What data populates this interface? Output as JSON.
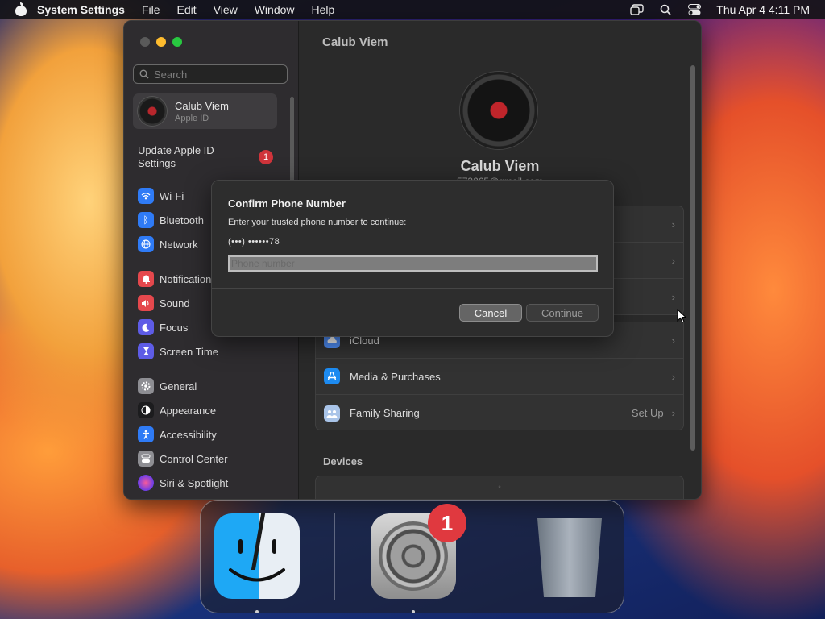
{
  "menubar": {
    "app_name": "System Settings",
    "items": [
      "File",
      "Edit",
      "View",
      "Window",
      "Help"
    ],
    "clock": "Thu Apr 4  4:11 PM"
  },
  "sidebar": {
    "search_placeholder": "Search",
    "account": {
      "name": "Calub Viem",
      "subtitle": "Apple ID"
    },
    "update": {
      "label": "Update Apple ID Settings",
      "badge": "1"
    },
    "items": [
      {
        "label": "Wi-Fi",
        "icon": "wifi-icon",
        "color": "#2f7bf6"
      },
      {
        "label": "Bluetooth",
        "icon": "bluetooth-icon",
        "color": "#2f7bf6"
      },
      {
        "label": "Network",
        "icon": "globe-icon",
        "color": "#2f7bf6"
      },
      {
        "label": "Notifications",
        "icon": "bell-icon",
        "color": "#e5484d"
      },
      {
        "label": "Sound",
        "icon": "speaker-icon",
        "color": "#e5484d"
      },
      {
        "label": "Focus",
        "icon": "moon-icon",
        "color": "#5e5ce6"
      },
      {
        "label": "Screen Time",
        "icon": "hourglass-icon",
        "color": "#5e5ce6"
      },
      {
        "label": "General",
        "icon": "gear-icon",
        "color": "#8e8e93"
      },
      {
        "label": "Appearance",
        "icon": "appearance-icon",
        "color": "#1c1c1e"
      },
      {
        "label": "Accessibility",
        "icon": "accessibility-icon",
        "color": "#2f7bf6"
      },
      {
        "label": "Control Center",
        "icon": "control-center-icon",
        "color": "#8e8e93"
      },
      {
        "label": "Siri & Spotlight",
        "icon": "siri-icon",
        "color": "#c0427a"
      }
    ]
  },
  "main": {
    "title": "Calub Viem",
    "profile_name": "Calub Viem",
    "profile_email": "573265@gmail.com",
    "group2": [
      {
        "label": "iCloud",
        "icon": "icloud-icon",
        "value": ""
      },
      {
        "label": "Media & Purchases",
        "icon": "app-store-icon",
        "value": ""
      },
      {
        "label": "Family Sharing",
        "icon": "family-icon",
        "value": "Set Up"
      }
    ],
    "devices_title": "Devices"
  },
  "dialog": {
    "title": "Confirm Phone Number",
    "message": "Enter your trusted phone number to continue:",
    "phone_hint": "(•••) ••••••78",
    "placeholder": "Phone number",
    "cancel_label": "Cancel",
    "continue_label": "Continue"
  },
  "dock": {
    "apps": [
      "Finder",
      "System Settings",
      "Trash"
    ],
    "settings_badge": "1"
  }
}
